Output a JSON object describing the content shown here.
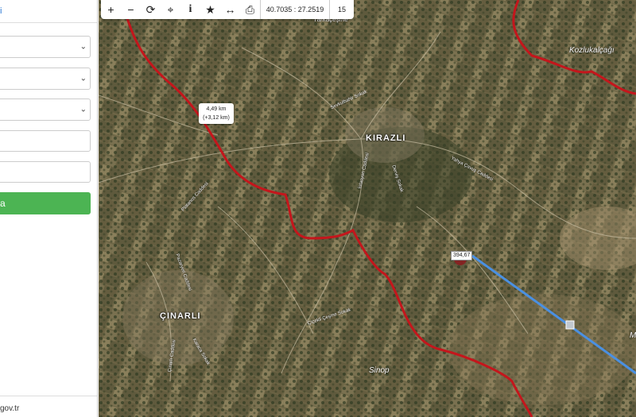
{
  "sidebar": {
    "top_link": "i",
    "selects": [
      "",
      "",
      ""
    ],
    "inputs": [
      "",
      ""
    ],
    "button_label": "a",
    "footer_text": "gov.tr"
  },
  "toolbar": {
    "buttons": [
      {
        "name": "zoom-in",
        "glyph": "+"
      },
      {
        "name": "zoom-out",
        "glyph": "−"
      },
      {
        "name": "refresh",
        "glyph": "⟳"
      },
      {
        "name": "locate",
        "glyph": "⌖"
      },
      {
        "name": "info",
        "glyph": "i"
      },
      {
        "name": "favorite",
        "glyph": "★"
      },
      {
        "name": "measure",
        "glyph": "↔"
      },
      {
        "name": "print",
        "glyph": "⎙"
      }
    ],
    "coordinates": "40.7035 : 27.2519",
    "zoom_level": "15"
  },
  "map": {
    "places": {
      "kirazli": "KIRAZLI",
      "cinarli": "ÇINARLI",
      "kozlukalcagi": "Kozlukalçağı",
      "sinop": "Sinop",
      "yarkacesme": "Yarkaçeşme",
      "m_edge": "M"
    },
    "streets": {
      "sevkulbahir": "Sevkulbahir Sokak",
      "yahya": "Yahya Çavuş Caddesi",
      "platanos": "Platanos Caddesi",
      "dervis": "Derviş Sokak",
      "istasyon": "İstasyon Caddesi",
      "pazaryeri": "Pazaryeri Caddesi",
      "cinarli_cd": "Çınarlı Caddesi",
      "karaca": "Karaca Sokak",
      "cicekli": "Çiçekli Çeşme Sokak"
    },
    "measure_tooltip": {
      "distance": "4,49 km",
      "delta": "(+3,12 km)"
    },
    "poi_label": "394,67",
    "colors": {
      "boundary": "#c4161c",
      "route": "#4a90e2"
    }
  }
}
